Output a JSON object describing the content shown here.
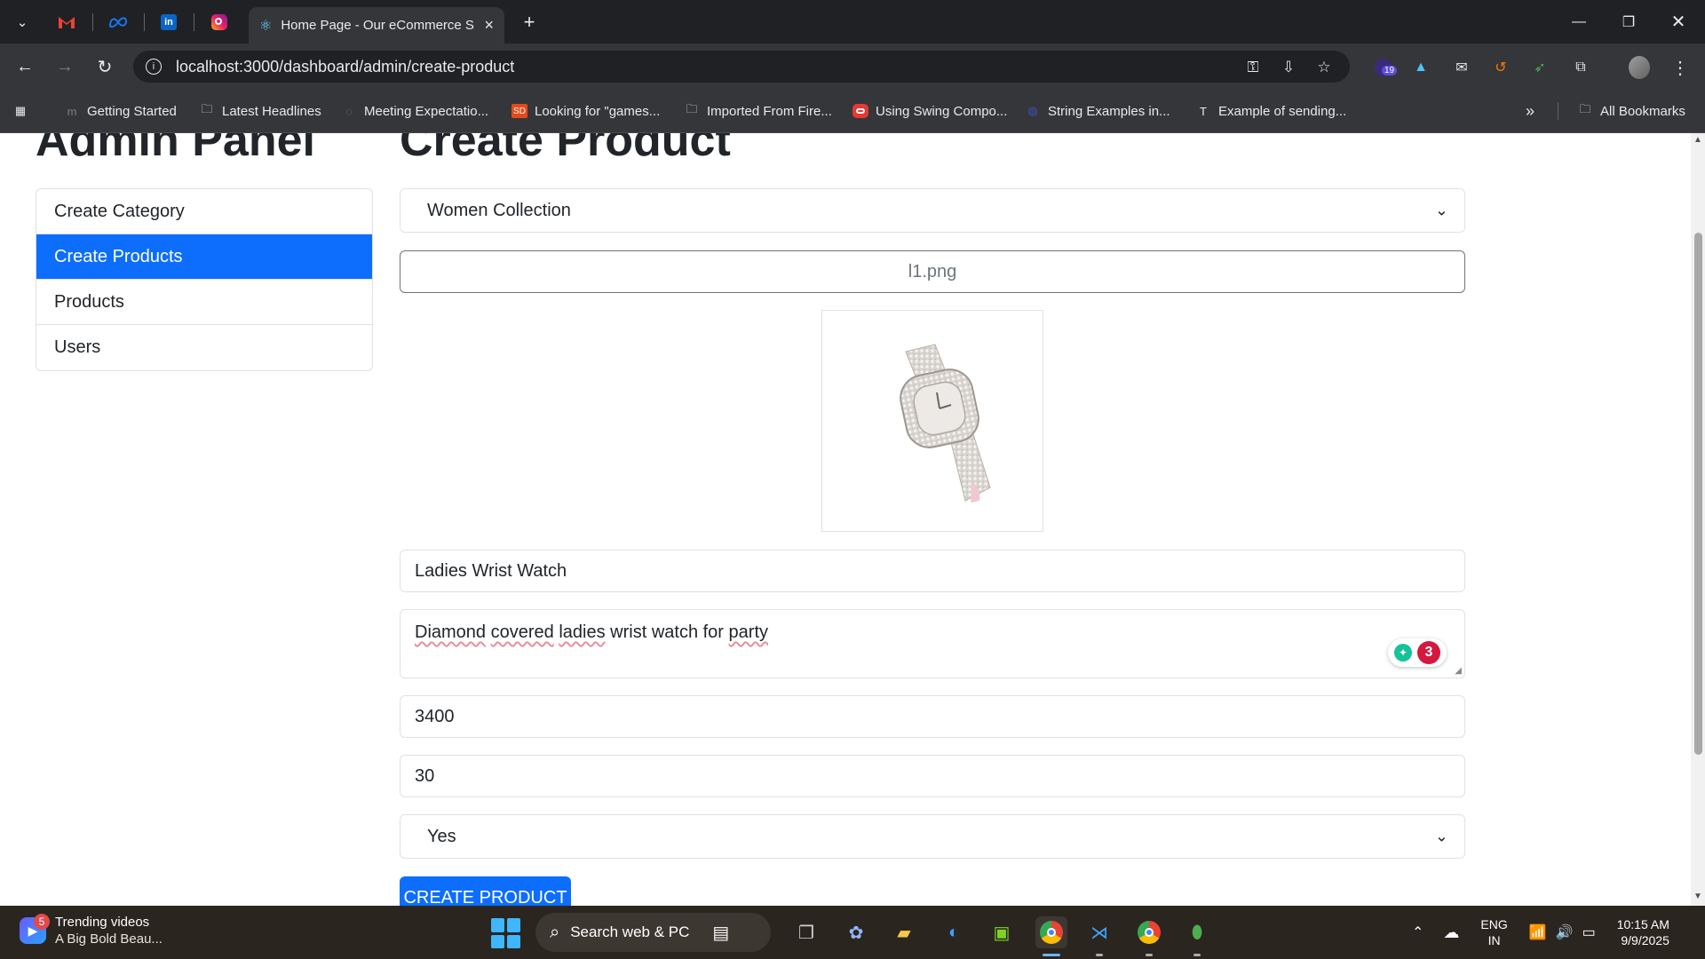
{
  "browser": {
    "tabs": {
      "dropdown_icon": "chevron-down-icon",
      "pinned_icons": [
        "gmail-icon",
        "meta-icon",
        "linkedin-icon",
        "instagram-icon"
      ],
      "active_tab_title": "Home Page - Our eCommerce S",
      "new_tab_symbol": "+",
      "close_symbol": "×"
    },
    "address_bar": {
      "url": "localhost:3000/dashboard/admin/create-product"
    },
    "bookmarks": [
      {
        "label": "Getting Started",
        "icon": "m-icon"
      },
      {
        "label": "Latest Headlines",
        "icon": "folder-icon"
      },
      {
        "label": "Meeting Expectatio...",
        "icon": "globe-icon"
      },
      {
        "label": "Looking for \"games...",
        "icon": "sd-icon"
      },
      {
        "label": "Imported From Fire...",
        "icon": "folder-icon"
      },
      {
        "label": "Using Swing Compo...",
        "icon": "oracle-icon"
      },
      {
        "label": "String Examples in...",
        "icon": "globe-icon"
      },
      {
        "label": "Example of sending...",
        "icon": "t-icon"
      }
    ],
    "all_bookmarks_label": "All Bookmarks",
    "extension_badge": "19"
  },
  "sidebar": {
    "title": "Admin Panel",
    "items": [
      {
        "label": "Create Category"
      },
      {
        "label": "Create Products"
      },
      {
        "label": "Products"
      },
      {
        "label": "Users"
      }
    ],
    "active_index": 1
  },
  "form": {
    "title": "Create Product",
    "category_value": "Women Collection",
    "file_label": "l1.png",
    "preview_icon": "wrist-watch-image",
    "name_value": "Ladies Wrist Watch",
    "description_words": [
      "Diamond",
      "covered",
      "ladies",
      "wrist watch for",
      "party"
    ],
    "price_value": "3400",
    "quantity_value": "30",
    "shipping_value": "Yes",
    "grammarly_count": "3",
    "submit_label": "CREATE PRODUCT"
  },
  "taskbar": {
    "widget_badge": "5",
    "widget_title": "Trending videos",
    "widget_subtitle": "A Big Bold Beau...",
    "search_label": "Search web & PC",
    "language": "ENG",
    "region": "IN",
    "time": "10:15 AM",
    "date": "9/9/2025"
  },
  "colors": {
    "primary": "#0d6efd",
    "chrome_dark": "#202124",
    "chrome_toolbar": "#35363a",
    "grammarly_red": "#d3193d",
    "grammarly_green": "#15c39a"
  }
}
